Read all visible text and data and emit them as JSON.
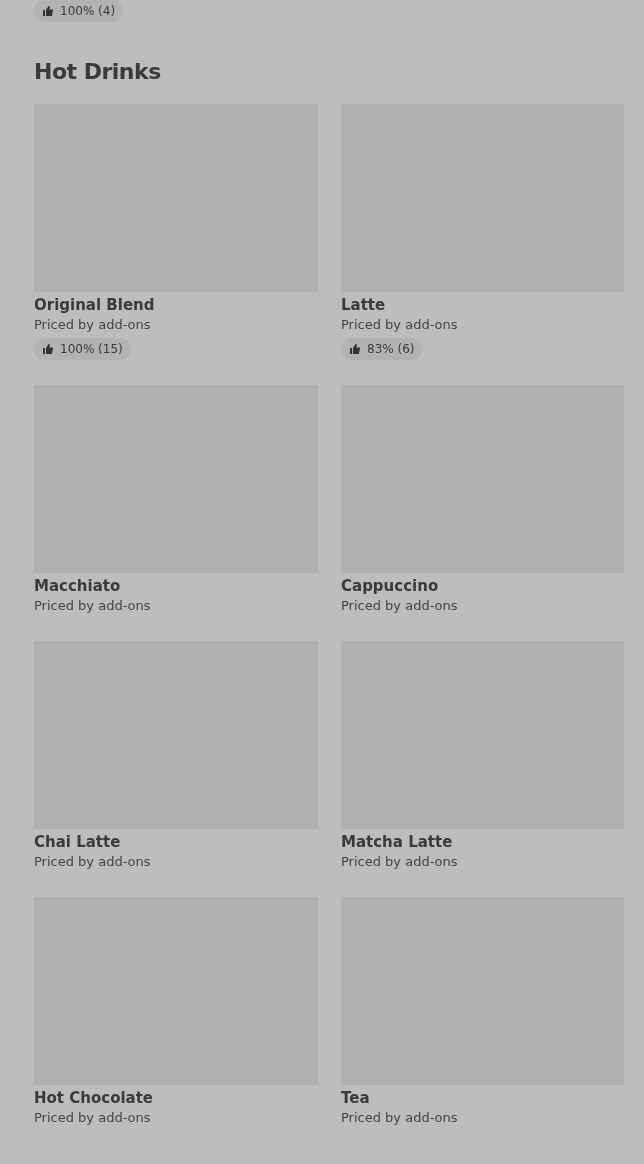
{
  "previous_item": {
    "rating": "100% (4)"
  },
  "section": {
    "title": "Hot Drinks",
    "items": [
      {
        "name": "Original Blend",
        "price": "Priced by add-ons",
        "rating": "100% (15)"
      },
      {
        "name": "Latte",
        "price": "Priced by add-ons",
        "rating": "83% (6)"
      },
      {
        "name": "Macchiato",
        "price": "Priced by add-ons"
      },
      {
        "name": "Cappuccino",
        "price": "Priced by add-ons"
      },
      {
        "name": "Chai Latte",
        "price": "Priced by add-ons"
      },
      {
        "name": "Matcha Latte",
        "price": "Priced by add-ons"
      },
      {
        "name": "Hot Chocolate",
        "price": "Priced by add-ons"
      },
      {
        "name": "Tea",
        "price": "Priced by add-ons"
      }
    ]
  }
}
